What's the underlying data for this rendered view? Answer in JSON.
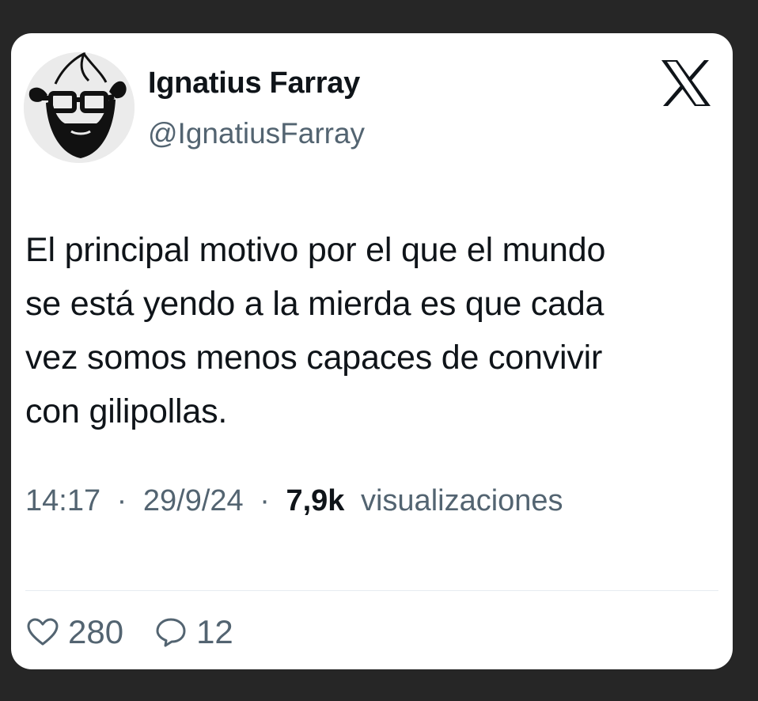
{
  "tweet": {
    "author": {
      "display_name": "Ignatius Farray",
      "handle": "@IgnatiusFarray",
      "avatar_icon": "bearded-man-with-glasses-icon"
    },
    "platform_logo": "x-logo",
    "text_lines": [
      "El principal motivo por el que el mundo",
      "se está yendo a la mierda es que cada",
      "vez somos menos capaces de convivir",
      "con gilipollas."
    ],
    "time": "14:17",
    "separator": "·",
    "date": "29/9/24",
    "views_count": "7,9k",
    "views_label": "visualizaciones",
    "likes": "280",
    "replies": "12"
  },
  "colors": {
    "background": "#262626",
    "card": "#ffffff",
    "text_primary": "#0f1419",
    "text_secondary": "#536471",
    "divider": "#e6ecf0"
  }
}
